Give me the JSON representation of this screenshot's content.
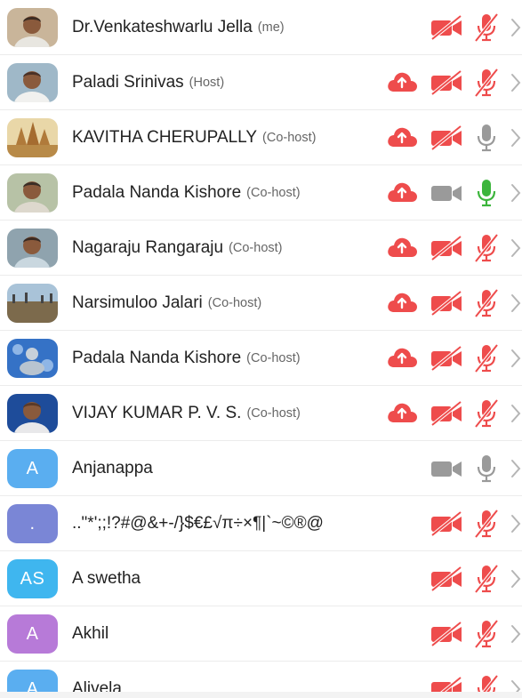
{
  "colors": {
    "accent_red": "#ee4c4c",
    "mic_on_green": "#3cb53c",
    "icon_gray": "#9a9a9a",
    "chevron_gray": "#b5b5b5"
  },
  "participants": [
    {
      "name": "Dr.Venkateshwarlu Jella",
      "role": "(me)",
      "avatar": "photo",
      "cloud": false,
      "video": "off",
      "mic": "off"
    },
    {
      "name": "Paladi Srinivas",
      "role": "(Host)",
      "avatar": "photo",
      "cloud": true,
      "video": "off",
      "mic": "off"
    },
    {
      "name": "KAVITHA CHERUPALLY",
      "role": "(Co-host)",
      "avatar": "temple-photo",
      "cloud": true,
      "video": "off",
      "mic": "on-idle"
    },
    {
      "name": "Padala Nanda Kishore",
      "role": "(Co-host)",
      "avatar": "photo",
      "cloud": true,
      "video": "on",
      "mic": "speaking"
    },
    {
      "name": "Nagaraju Rangaraju",
      "role": "(Co-host)",
      "avatar": "photo",
      "cloud": true,
      "video": "off",
      "mic": "off"
    },
    {
      "name": "Narsimuloo Jalari",
      "role": "(Co-host)",
      "avatar": "landscape-photo",
      "cloud": true,
      "video": "off",
      "mic": "off"
    },
    {
      "name": "Padala Nanda Kishore",
      "role": "(Co-host)",
      "avatar": "buddha-photo",
      "cloud": true,
      "video": "off",
      "mic": "off"
    },
    {
      "name": "VIJAY KUMAR P. V. S.",
      "role": "(Co-host)",
      "avatar": "photo",
      "cloud": true,
      "video": "off",
      "mic": "off"
    },
    {
      "name": "Anjanappa",
      "role": "",
      "avatar": "initial",
      "initial": "A",
      "avatar_color": "#5aaef0",
      "cloud": false,
      "video": "on",
      "mic": "on-idle"
    },
    {
      "name": "..\"*';;!?#@&+-/}$€£√π÷×¶|`~©®@",
      "role": "",
      "avatar": "initial",
      "initial": ".",
      "avatar_color": "#7a86d6",
      "cloud": false,
      "video": "off",
      "mic": "off"
    },
    {
      "name": "A swetha",
      "role": "",
      "avatar": "initial",
      "initial": "AS",
      "avatar_color": "#3fb6ef",
      "cloud": false,
      "video": "off",
      "mic": "off"
    },
    {
      "name": "Akhil",
      "role": "",
      "avatar": "initial",
      "initial": "A",
      "avatar_color": "#b77ad8",
      "cloud": false,
      "video": "off",
      "mic": "off"
    },
    {
      "name": "Alivela",
      "role": "",
      "avatar": "initial",
      "initial": "A",
      "avatar_color": "#5aaef0",
      "cloud": false,
      "video": "off",
      "mic": "off"
    }
  ]
}
